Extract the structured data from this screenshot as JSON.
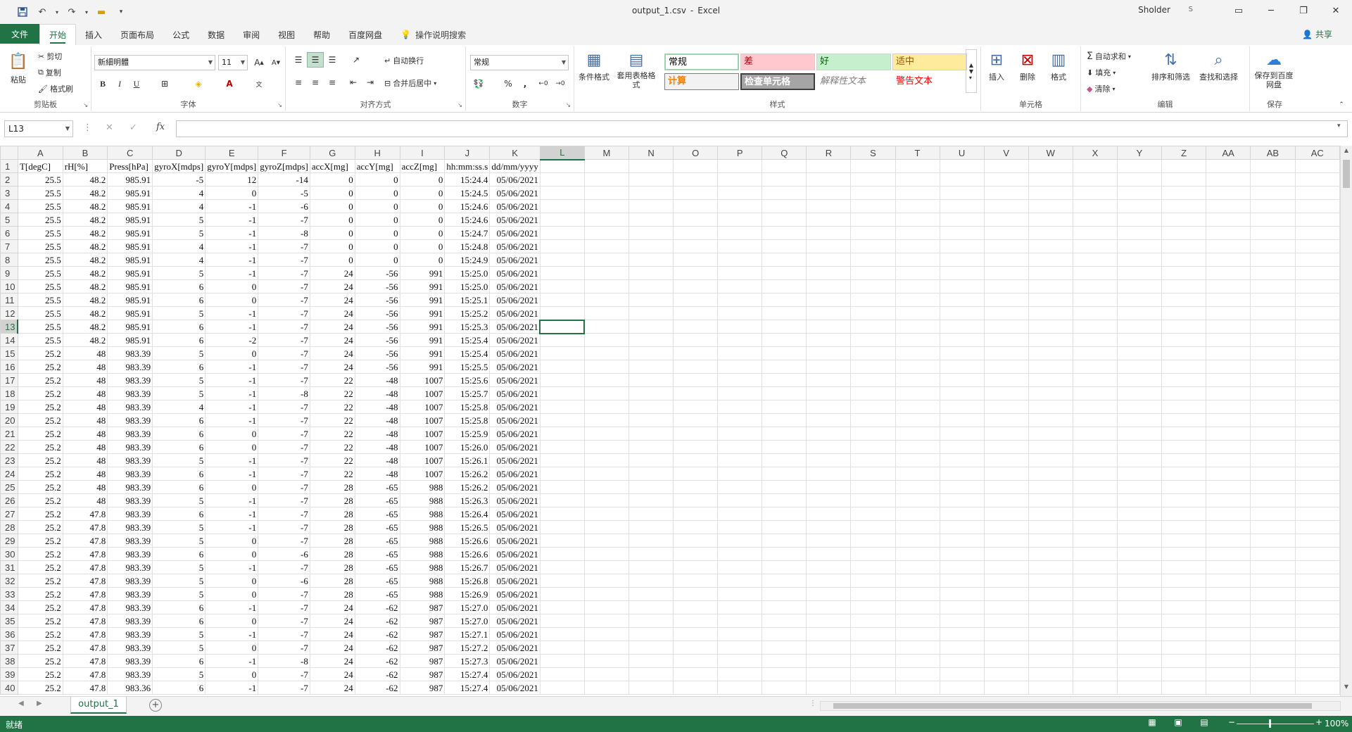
{
  "titlebar": {
    "filename": "output_1.csv",
    "app": "Excel",
    "separator": "-",
    "user": "Sholder",
    "user_badge": "S"
  },
  "tabs": [
    "文件",
    "开始",
    "插入",
    "页面布局",
    "公式",
    "数据",
    "审阅",
    "视图",
    "帮助",
    "百度网盘",
    "操作说明搜索"
  ],
  "share_label": "共享",
  "ribbon": {
    "clipboard": {
      "paste": "粘贴",
      "cut": "剪切",
      "copy": "复制",
      "format_painter": "格式刷",
      "label": "剪贴板"
    },
    "font": {
      "name": "新細明體",
      "size": "11",
      "label": "字体",
      "bold": "B",
      "italic": "I",
      "underline": "U"
    },
    "alignment": {
      "wrap": "自动换行",
      "merge": "合并后居中",
      "label": "对齐方式"
    },
    "number": {
      "format": "常规",
      "percent": "%",
      "comma": ",",
      "label": "数字"
    },
    "styles": {
      "conditional": "条件格式",
      "table_format": "套用表格格式",
      "cells": [
        "常规",
        "差",
        "好",
        "适中",
        "计算",
        "检查单元格",
        "解释性文本",
        "警告文本"
      ],
      "label": "样式"
    },
    "cells": {
      "insert": "插入",
      "delete": "删除",
      "format": "格式",
      "label": "单元格"
    },
    "editing": {
      "autosum": "自动求和",
      "fill": "填充",
      "clear": "清除",
      "sort": "排序和筛选",
      "find": "查找和选择",
      "label": "编辑"
    },
    "save": {
      "button": "保存到百度网盘",
      "label": "保存"
    }
  },
  "formula_bar": {
    "name_box": "L13",
    "fx": "fx",
    "content": ""
  },
  "grid": {
    "columns": [
      "A",
      "B",
      "C",
      "D",
      "E",
      "F",
      "G",
      "H",
      "I",
      "J",
      "K",
      "L",
      "M",
      "N",
      "O",
      "P",
      "Q",
      "R",
      "S",
      "T",
      "U",
      "V",
      "W",
      "X",
      "Y",
      "Z",
      "AA",
      "AB",
      "AC"
    ],
    "header_row": [
      "T[degC]",
      "rH[%]",
      "Press[hPa]",
      "gyroX[mdps]",
      "gyroY[mdps]",
      "gyroZ[mdps]",
      "accX[mg]",
      "accY[mg]",
      "accZ[mg]",
      "hh:mm:ss.s",
      "dd/mm/yyyy"
    ],
    "rows": [
      [
        "25.5",
        "48.2",
        "985.91",
        "-5",
        "12",
        "-14",
        "0",
        "0",
        "0",
        "15:24.4",
        "05/06/2021"
      ],
      [
        "25.5",
        "48.2",
        "985.91",
        "4",
        "0",
        "-5",
        "0",
        "0",
        "0",
        "15:24.5",
        "05/06/2021"
      ],
      [
        "25.5",
        "48.2",
        "985.91",
        "4",
        "-1",
        "-6",
        "0",
        "0",
        "0",
        "15:24.6",
        "05/06/2021"
      ],
      [
        "25.5",
        "48.2",
        "985.91",
        "5",
        "-1",
        "-7",
        "0",
        "0",
        "0",
        "15:24.6",
        "05/06/2021"
      ],
      [
        "25.5",
        "48.2",
        "985.91",
        "5",
        "-1",
        "-8",
        "0",
        "0",
        "0",
        "15:24.7",
        "05/06/2021"
      ],
      [
        "25.5",
        "48.2",
        "985.91",
        "4",
        "-1",
        "-7",
        "0",
        "0",
        "0",
        "15:24.8",
        "05/06/2021"
      ],
      [
        "25.5",
        "48.2",
        "985.91",
        "4",
        "-1",
        "-7",
        "0",
        "0",
        "0",
        "15:24.9",
        "05/06/2021"
      ],
      [
        "25.5",
        "48.2",
        "985.91",
        "5",
        "-1",
        "-7",
        "24",
        "-56",
        "991",
        "15:25.0",
        "05/06/2021"
      ],
      [
        "25.5",
        "48.2",
        "985.91",
        "6",
        "0",
        "-7",
        "24",
        "-56",
        "991",
        "15:25.0",
        "05/06/2021"
      ],
      [
        "25.5",
        "48.2",
        "985.91",
        "6",
        "0",
        "-7",
        "24",
        "-56",
        "991",
        "15:25.1",
        "05/06/2021"
      ],
      [
        "25.5",
        "48.2",
        "985.91",
        "5",
        "-1",
        "-7",
        "24",
        "-56",
        "991",
        "15:25.2",
        "05/06/2021"
      ],
      [
        "25.5",
        "48.2",
        "985.91",
        "6",
        "-1",
        "-7",
        "24",
        "-56",
        "991",
        "15:25.3",
        "05/06/2021"
      ],
      [
        "25.5",
        "48.2",
        "985.91",
        "6",
        "-2",
        "-7",
        "24",
        "-56",
        "991",
        "15:25.4",
        "05/06/2021"
      ],
      [
        "25.2",
        "48",
        "983.39",
        "5",
        "0",
        "-7",
        "24",
        "-56",
        "991",
        "15:25.4",
        "05/06/2021"
      ],
      [
        "25.2",
        "48",
        "983.39",
        "6",
        "-1",
        "-7",
        "24",
        "-56",
        "991",
        "15:25.5",
        "05/06/2021"
      ],
      [
        "25.2",
        "48",
        "983.39",
        "5",
        "-1",
        "-7",
        "22",
        "-48",
        "1007",
        "15:25.6",
        "05/06/2021"
      ],
      [
        "25.2",
        "48",
        "983.39",
        "5",
        "-1",
        "-8",
        "22",
        "-48",
        "1007",
        "15:25.7",
        "05/06/2021"
      ],
      [
        "25.2",
        "48",
        "983.39",
        "4",
        "-1",
        "-7",
        "22",
        "-48",
        "1007",
        "15:25.8",
        "05/06/2021"
      ],
      [
        "25.2",
        "48",
        "983.39",
        "6",
        "-1",
        "-7",
        "22",
        "-48",
        "1007",
        "15:25.8",
        "05/06/2021"
      ],
      [
        "25.2",
        "48",
        "983.39",
        "6",
        "0",
        "-7",
        "22",
        "-48",
        "1007",
        "15:25.9",
        "05/06/2021"
      ],
      [
        "25.2",
        "48",
        "983.39",
        "6",
        "0",
        "-7",
        "22",
        "-48",
        "1007",
        "15:26.0",
        "05/06/2021"
      ],
      [
        "25.2",
        "48",
        "983.39",
        "5",
        "-1",
        "-7",
        "22",
        "-48",
        "1007",
        "15:26.1",
        "05/06/2021"
      ],
      [
        "25.2",
        "48",
        "983.39",
        "6",
        "-1",
        "-7",
        "22",
        "-48",
        "1007",
        "15:26.2",
        "05/06/2021"
      ],
      [
        "25.2",
        "48",
        "983.39",
        "6",
        "0",
        "-7",
        "28",
        "-65",
        "988",
        "15:26.2",
        "05/06/2021"
      ],
      [
        "25.2",
        "48",
        "983.39",
        "5",
        "-1",
        "-7",
        "28",
        "-65",
        "988",
        "15:26.3",
        "05/06/2021"
      ],
      [
        "25.2",
        "47.8",
        "983.39",
        "6",
        "-1",
        "-7",
        "28",
        "-65",
        "988",
        "15:26.4",
        "05/06/2021"
      ],
      [
        "25.2",
        "47.8",
        "983.39",
        "5",
        "-1",
        "-7",
        "28",
        "-65",
        "988",
        "15:26.5",
        "05/06/2021"
      ],
      [
        "25.2",
        "47.8",
        "983.39",
        "5",
        "0",
        "-7",
        "28",
        "-65",
        "988",
        "15:26.6",
        "05/06/2021"
      ],
      [
        "25.2",
        "47.8",
        "983.39",
        "6",
        "0",
        "-6",
        "28",
        "-65",
        "988",
        "15:26.6",
        "05/06/2021"
      ],
      [
        "25.2",
        "47.8",
        "983.39",
        "5",
        "-1",
        "-7",
        "28",
        "-65",
        "988",
        "15:26.7",
        "05/06/2021"
      ],
      [
        "25.2",
        "47.8",
        "983.39",
        "5",
        "0",
        "-6",
        "28",
        "-65",
        "988",
        "15:26.8",
        "05/06/2021"
      ],
      [
        "25.2",
        "47.8",
        "983.39",
        "5",
        "0",
        "-7",
        "28",
        "-65",
        "988",
        "15:26.9",
        "05/06/2021"
      ],
      [
        "25.2",
        "47.8",
        "983.39",
        "6",
        "-1",
        "-7",
        "24",
        "-62",
        "987",
        "15:27.0",
        "05/06/2021"
      ],
      [
        "25.2",
        "47.8",
        "983.39",
        "6",
        "0",
        "-7",
        "24",
        "-62",
        "987",
        "15:27.0",
        "05/06/2021"
      ],
      [
        "25.2",
        "47.8",
        "983.39",
        "5",
        "-1",
        "-7",
        "24",
        "-62",
        "987",
        "15:27.1",
        "05/06/2021"
      ],
      [
        "25.2",
        "47.8",
        "983.39",
        "5",
        "0",
        "-7",
        "24",
        "-62",
        "987",
        "15:27.2",
        "05/06/2021"
      ],
      [
        "25.2",
        "47.8",
        "983.39",
        "6",
        "-1",
        "-8",
        "24",
        "-62",
        "987",
        "15:27.3",
        "05/06/2021"
      ],
      [
        "25.2",
        "47.8",
        "983.39",
        "5",
        "0",
        "-7",
        "24",
        "-62",
        "987",
        "15:27.4",
        "05/06/2021"
      ],
      [
        "25.2",
        "47.8",
        "983.36",
        "6",
        "-1",
        "-7",
        "24",
        "-62",
        "987",
        "15:27.4",
        "05/06/2021"
      ]
    ],
    "active_cell": "L13"
  },
  "sheet_tabs": [
    "output_1"
  ],
  "status": {
    "text": "就绪",
    "zoom": "100%"
  }
}
